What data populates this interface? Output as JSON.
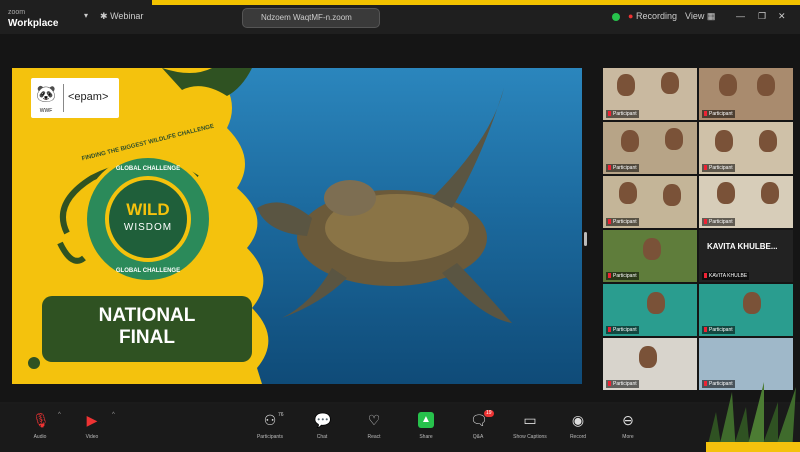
{
  "window": {
    "brand_small": "zoom",
    "brand_name": "Workplace",
    "tab_label": "Webinar",
    "url": "Ndzoem WaqtMF-n.zoom",
    "recording_label": "Recording",
    "view_label": "View"
  },
  "slide": {
    "logo_left": "WWF",
    "logo_right": "<epam>",
    "arc_text": "FINDING THE BIGGEST WILDLIFE CHALLENGE",
    "ring_top": "GLOBAL CHALLENGE",
    "ring_bottom": "GLOBAL CHALLENGE",
    "wild": "WILD",
    "wisdom": "WISDOM",
    "final_line1": "NATIONAL",
    "final_line2": "FINAL"
  },
  "gallery": {
    "tiles": [
      {
        "name": "Participant"
      },
      {
        "name": "Participant"
      },
      {
        "name": "Participant"
      },
      {
        "name": "Participant"
      },
      {
        "name": "Participant"
      },
      {
        "name": "Participant"
      },
      {
        "name": "Participant"
      },
      {
        "name": "Participant"
      },
      {
        "name": "Participant"
      },
      {
        "name": "KAVITA KHULBE"
      },
      {
        "name": "Participant"
      },
      {
        "name": "Participant"
      },
      {
        "name": "Participant"
      },
      {
        "name": "Participant"
      }
    ],
    "big_label": "KAVITA KHULBE..."
  },
  "toolbar": {
    "audio": "Audio",
    "video": "Video",
    "participants": "Participants",
    "participants_count": "76",
    "chat": "Chat",
    "react": "React",
    "share": "Share",
    "qa": "Q&A",
    "qa_badge": "19",
    "more_captions": "Show Captions",
    "record": "Record",
    "more": "More"
  },
  "colors": {
    "accent_yellow": "#f2c200",
    "slide_green": "#2f5222",
    "share_green": "#27c24c"
  }
}
